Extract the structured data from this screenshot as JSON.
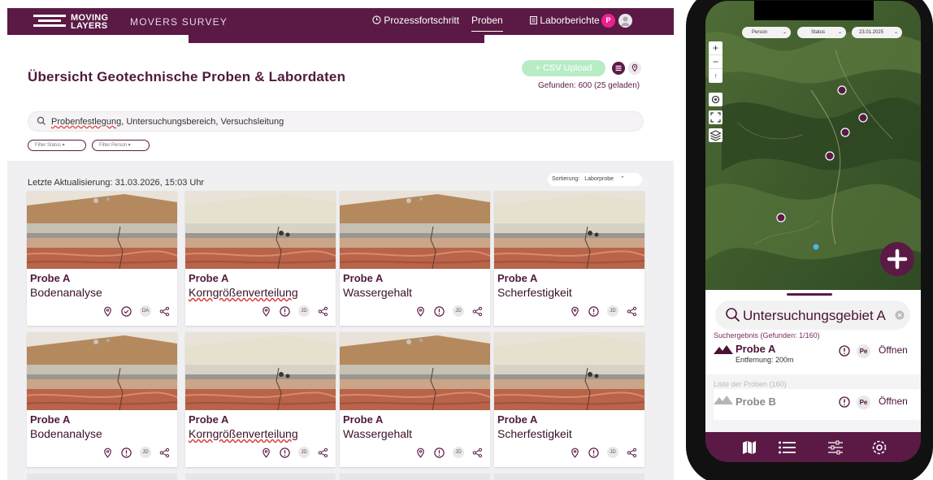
{
  "header": {
    "logo_top": "MOVING",
    "logo_bottom": "LAYERS",
    "app_name": "MOVERS SURVEY",
    "nav": [
      {
        "label": "Prozessfortschritt"
      },
      {
        "label": "Proben"
      },
      {
        "label": "Laborberichte"
      }
    ],
    "avatar_initial": "P"
  },
  "page": {
    "title": "Übersicht  Geotechnische Proben & Labordaten",
    "csv_button": "+ CSV Upload",
    "found": "Gefunden: 600 (25 geladen)"
  },
  "search": {
    "term_underlined": "Probenfestlegung",
    "rest": ", Untersuchungsbereich, Versuchsleitung"
  },
  "filters": [
    {
      "label": "Filter Status ▾"
    },
    {
      "label": "Filter Person ▾"
    }
  ],
  "list": {
    "updated": "Letzte Aktualisierung: 31.03.2026, 15:03 Uhr",
    "sort_label": "Sortierung:",
    "sort_value": "Laborprobe",
    "cards": [
      {
        "name": "Probe A",
        "analysis": "Bodenanalyse",
        "status": "check",
        "initials": "DA",
        "spell": false
      },
      {
        "name": "Probe A",
        "analysis": "Korngrößenverteilung",
        "status": "alert",
        "initials": "JD",
        "spell": true
      },
      {
        "name": "Probe A",
        "analysis": "Wassergehalt",
        "status": "alert",
        "initials": "JD",
        "spell": false
      },
      {
        "name": "Probe A",
        "analysis": "Scherfestigkeit",
        "status": "alert",
        "initials": "JD",
        "spell": false
      },
      {
        "name": "Probe A",
        "analysis": "Bodenanalyse",
        "status": "alert",
        "initials": "JD",
        "spell": false
      },
      {
        "name": "Probe A",
        "analysis": "Korngrößenverteilung",
        "status": "alert",
        "initials": "JD",
        "spell": true
      },
      {
        "name": "Probe A",
        "analysis": "Wassergehalt",
        "status": "alert",
        "initials": "JD",
        "spell": false
      },
      {
        "name": "Probe A",
        "analysis": "Scherfestigkeit",
        "status": "alert",
        "initials": "JD",
        "spell": false
      }
    ]
  },
  "mobile": {
    "chips": [
      {
        "label": "Person"
      },
      {
        "label": "Status"
      },
      {
        "label": "23.01.2025"
      }
    ],
    "search": "Untersuchungsgebiet A",
    "result_label": "Suchergebnis (Gefunden: 1/160)",
    "result": {
      "name": "Probe A",
      "distance": "Entfernung: 200m",
      "badge": "Pe",
      "open": "Öffnen"
    },
    "list_label": "Liste der Proben (160)",
    "list_item": {
      "name": "Probe B",
      "badge": "Pe",
      "open": "Öffnen"
    }
  },
  "colors": {
    "brand": "#5b1a45",
    "accent_green": "#b8ecc5"
  }
}
